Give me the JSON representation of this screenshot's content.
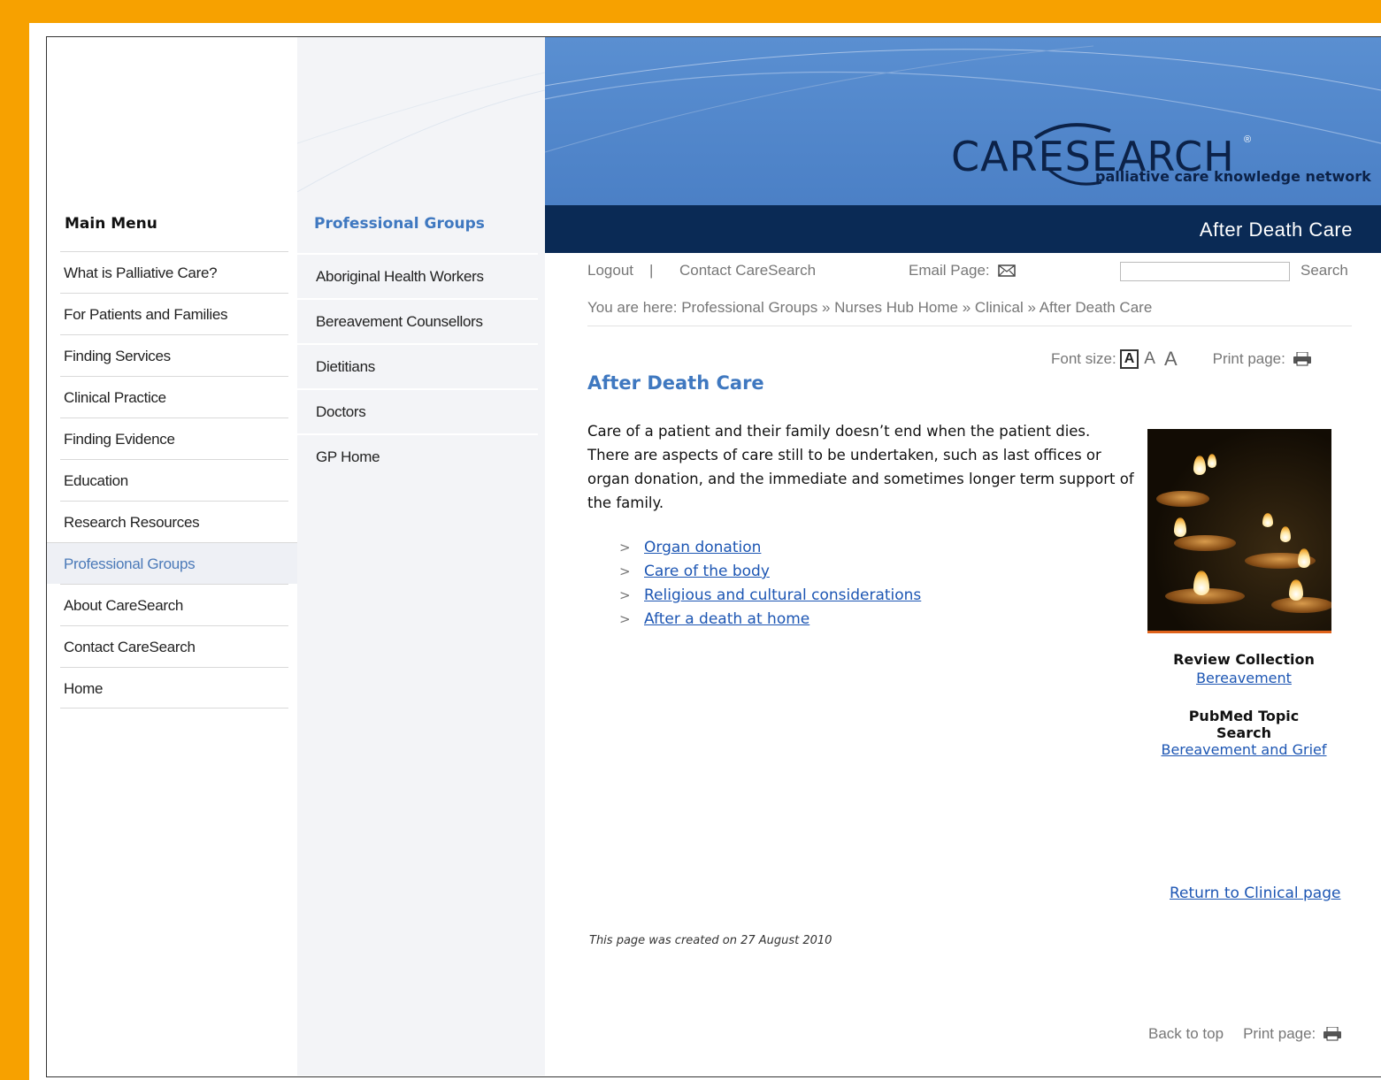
{
  "brand": {
    "logo_text": "CARESEARCH",
    "reg_mark": "®",
    "tagline": "palliative care knowledge network"
  },
  "banner_title": "After Death Care",
  "main_menu": {
    "heading": "Main Menu",
    "items": [
      {
        "label": "What is Palliative Care?"
      },
      {
        "label": "For Patients and Families"
      },
      {
        "label": "Finding Services"
      },
      {
        "label": "Clinical Practice"
      },
      {
        "label": "Finding Evidence"
      },
      {
        "label": "Education"
      },
      {
        "label": "Research Resources"
      },
      {
        "label": "Professional Groups",
        "active": true
      },
      {
        "label": "About CareSearch"
      },
      {
        "label": "Contact CareSearch"
      },
      {
        "label": "Home"
      }
    ]
  },
  "sub_menu": {
    "heading": "Professional Groups",
    "items": [
      {
        "label": "Aboriginal Health Workers"
      },
      {
        "label": "Bereavement Counsellors"
      },
      {
        "label": "Dietitians"
      },
      {
        "label": "Doctors"
      },
      {
        "label": "GP Home"
      }
    ]
  },
  "toolbar": {
    "logout": "Logout",
    "separator": "|",
    "contact": "Contact CareSearch",
    "email_page": "Email Page:",
    "search_value": "",
    "search_button": "Search"
  },
  "breadcrumb": {
    "prefix": "You are here:",
    "items": [
      "Professional Groups",
      "Nurses Hub Home",
      "Clinical",
      "After Death Care"
    ],
    "separator": "»"
  },
  "font_size": {
    "label": "Font size:",
    "options": [
      "A",
      "A",
      "A"
    ]
  },
  "print_page_label": "Print page:",
  "content": {
    "title": "After Death Care",
    "intro": "Care of a patient and their family doesn’t end when the patient dies. There are aspects of care still to be undertaken, such as last offices or organ donation, and the immediate and sometimes longer term support of the family.",
    "bullet_marker": ">",
    "links": [
      {
        "label": "Organ donation"
      },
      {
        "label": "Care of the body"
      },
      {
        "label": "Religious and cultural considerations"
      },
      {
        "label": "After a death at home"
      }
    ]
  },
  "sidebar": {
    "review_heading": "Review Collection",
    "review_link": "Bereavement",
    "pubmed_heading_line1": "PubMed Topic",
    "pubmed_heading_line2": "Search",
    "pubmed_link": "Bereavement and Grief"
  },
  "return_link": "Return to Clinical page",
  "created_note": "This page was created on 27 August 2010",
  "footer": {
    "back_to_top": "Back to top",
    "print_page": "Print page:"
  },
  "colors": {
    "frame": "#f7a100",
    "banner": "#4b80c6",
    "darkbar": "#0a2a55",
    "heading_blue": "#3f78c0",
    "link": "#1d56b3"
  },
  "icons": {
    "email": "envelope-icon",
    "print": "printer-icon"
  }
}
